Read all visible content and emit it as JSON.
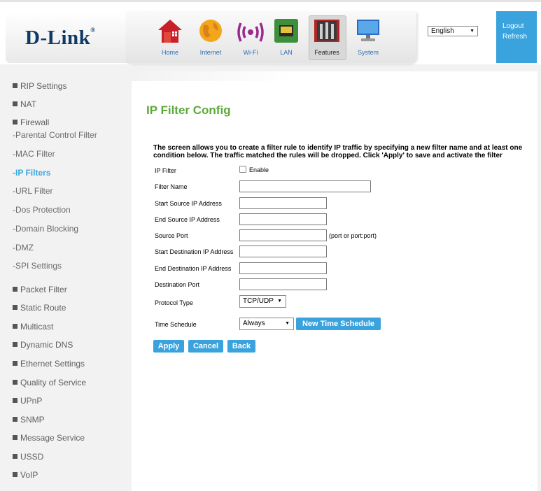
{
  "brand": {
    "logo": "D-Link"
  },
  "nav": [
    {
      "label": "Home",
      "icon": "home-icon"
    },
    {
      "label": "Internet",
      "icon": "globe-icon"
    },
    {
      "label": "Wi-Fi",
      "icon": "wifi-icon"
    },
    {
      "label": "LAN",
      "icon": "lan-port-icon"
    },
    {
      "label": "Features",
      "icon": "tools-icon"
    },
    {
      "label": "System",
      "icon": "monitor-icon"
    }
  ],
  "header": {
    "language": "English",
    "logout": "Logout",
    "refresh": "Refresh"
  },
  "sidebar": {
    "items": [
      {
        "label": "RIP Settings"
      },
      {
        "label": "NAT"
      },
      {
        "label": "Firewall"
      },
      {
        "label": "Packet Filter"
      },
      {
        "label": "Static Route"
      },
      {
        "label": "Multicast"
      },
      {
        "label": "Dynamic DNS"
      },
      {
        "label": "Ethernet Settings"
      },
      {
        "label": "Quality of Service"
      },
      {
        "label": "UPnP"
      },
      {
        "label": "SNMP"
      },
      {
        "label": "Message Service"
      },
      {
        "label": "USSD"
      },
      {
        "label": "VoIP"
      }
    ],
    "firewall_sub": [
      {
        "label": "-Parental Control Filter"
      },
      {
        "label": "-MAC Filter"
      },
      {
        "label": "-IP Filters"
      },
      {
        "label": "-URL Filter"
      },
      {
        "label": "-Dos Protection"
      },
      {
        "label": "-Domain Blocking"
      },
      {
        "label": "-DMZ"
      },
      {
        "label": "-SPI Settings"
      }
    ]
  },
  "page": {
    "title": "IP Filter Config",
    "description": "The screen allows you to create a filter rule to identify IP traffic by specifying a new filter name and at least one condition below. The traffic matched the rules will be dropped. Click 'Apply' to save and activate the filter"
  },
  "form": {
    "ip_filter_label": "IP Filter",
    "enable_label": "Enable",
    "enable_checked": false,
    "filter_name_label": "Filter Name",
    "start_src_label": "Start Source IP Address",
    "end_src_label": "End Source IP Address",
    "src_port_label": "Source Port",
    "port_note": "(port or port:port)",
    "start_dst_label": "Start Destination IP Address",
    "end_dst_label": "End Destination IP Address",
    "dst_port_label": "Destination Port",
    "protocol_label": "Protocol Type",
    "protocol_value": "TCP/UDP",
    "schedule_label": "Time Schedule",
    "schedule_value": "Always",
    "new_schedule_button": "New Time Schedule",
    "apply_button": "Apply",
    "cancel_button": "Cancel",
    "back_button": "Back"
  },
  "colors": {
    "accent": "#3aa3dd",
    "title_green": "#5ca939",
    "logo_navy": "#0f3a63"
  }
}
